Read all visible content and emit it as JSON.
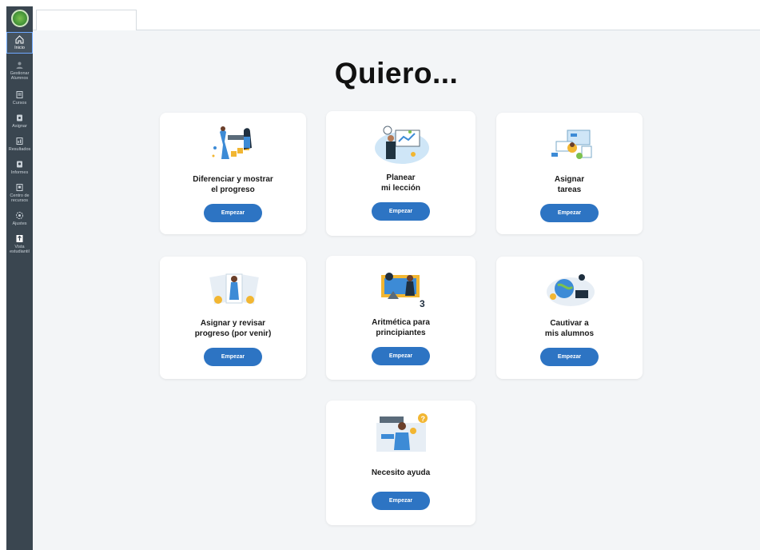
{
  "sidebar": {
    "items": [
      {
        "label": "Inicio",
        "icon": "home-icon"
      },
      {
        "label": "Gestionar\nAlumnos",
        "icon": "students-icon"
      },
      {
        "label": "Cursos",
        "icon": "courses-icon"
      },
      {
        "label": "Asignar",
        "icon": "assign-icon"
      },
      {
        "label": "Resultados",
        "icon": "results-icon"
      },
      {
        "label": "Informes",
        "icon": "reports-icon"
      },
      {
        "label": "Centro de\nrecursos",
        "icon": "resources-icon"
      },
      {
        "label": "Ajustes",
        "icon": "settings-icon"
      },
      {
        "label": "Vista\nestudiantil",
        "icon": "student-view-icon"
      }
    ]
  },
  "main": {
    "title": "Quiero...",
    "cards": [
      {
        "label": "Diferenciar y mostrar\nel progreso",
        "button": "Empezar"
      },
      {
        "label": "Planear\nmi lección",
        "button": "Empezar"
      },
      {
        "label": "Asignar\ntareas",
        "button": "Empezar"
      },
      {
        "label": "Asignar y revisar\nprogreso (por venir)",
        "button": "Empezar"
      },
      {
        "label": "Aritmética para\nprincipiantes",
        "button": "Empezar"
      },
      {
        "label": "Cautivar a\nmis alumnos",
        "button": "Empezar"
      },
      {
        "label": "Necesito ayuda",
        "button": "Empezar"
      }
    ]
  },
  "colors": {
    "sidebar": "#3a4650",
    "accent": "#2d74c3",
    "background": "#f3f5f7"
  }
}
